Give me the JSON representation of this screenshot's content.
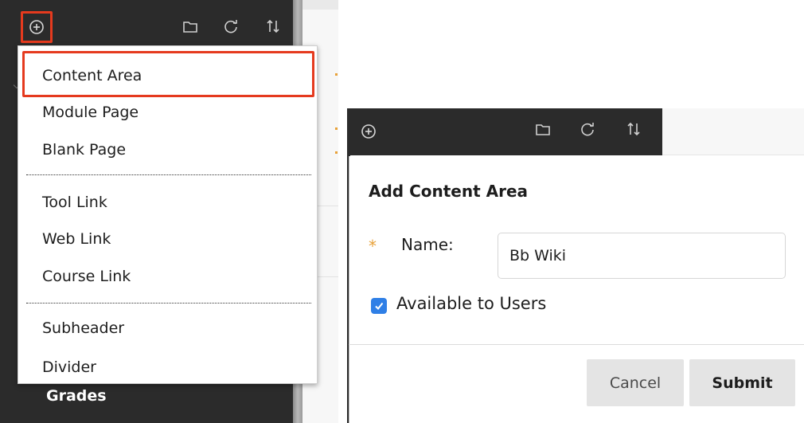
{
  "left": {
    "menu_items": {
      "content_area": "Content Area",
      "module_page": "Module Page",
      "blank_page": "Blank Page",
      "tool_link": "Tool Link",
      "web_link": "Web Link",
      "course_link": "Course Link",
      "subheader": "Subheader",
      "divider": "Divider"
    },
    "grades_label": "Grades",
    "icons": [
      "add-icon",
      "folder-icon",
      "refresh-icon",
      "sort-icon"
    ]
  },
  "right": {
    "icons": [
      "add-icon",
      "folder-icon",
      "refresh-icon",
      "sort-icon"
    ],
    "dialog": {
      "title": "Add Content Area",
      "required_mark": "*",
      "name_label": "Name:",
      "name_value": "Bb Wiki",
      "available_label": "Available to Users",
      "available_checked": true,
      "cancel_label": "Cancel",
      "submit_label": "Submit"
    }
  },
  "colors": {
    "sidebar": "#2b2b2b",
    "highlight": "#e53a1e",
    "checkbox": "#2f7fe6",
    "required": "#e8a23a"
  }
}
